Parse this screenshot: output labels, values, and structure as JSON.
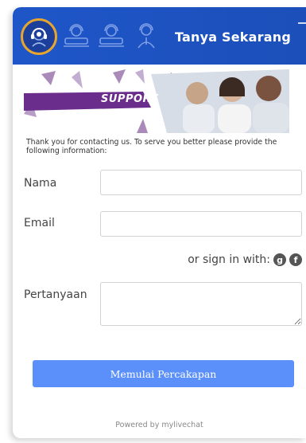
{
  "header": {
    "title": "Tanya Sekarang",
    "agents": [
      {
        "icon": "support-agent-icon",
        "state": "active"
      },
      {
        "icon": "agent-at-desk-icon",
        "state": "inactive"
      },
      {
        "icon": "agent-at-desk-icon",
        "state": "inactive"
      },
      {
        "icon": "agent-standing-icon",
        "state": "inactive"
      }
    ]
  },
  "banner": {
    "label": "SUPPORT"
  },
  "intro_text": "Thank you for contacting us. To serve you better please provide the following information:",
  "form": {
    "nama_label": "Nama",
    "nama_value": "",
    "email_label": "Email",
    "email_value": "",
    "signin_text": "or sign in with:",
    "pertanyaan_label": "Pertanyaan",
    "pertanyaan_value": "",
    "submit_label": "Memulai Percakapan"
  },
  "social": [
    "google-icon",
    "facebook-icon"
  ],
  "footer": {
    "powered_by": "Powered by mylivechat"
  },
  "colors": {
    "header_bg": "#1e56c9",
    "button_bg": "#5b8ff9",
    "agent_ring": "#e6a52f",
    "banner_ribbon": "#6b2d8b"
  }
}
